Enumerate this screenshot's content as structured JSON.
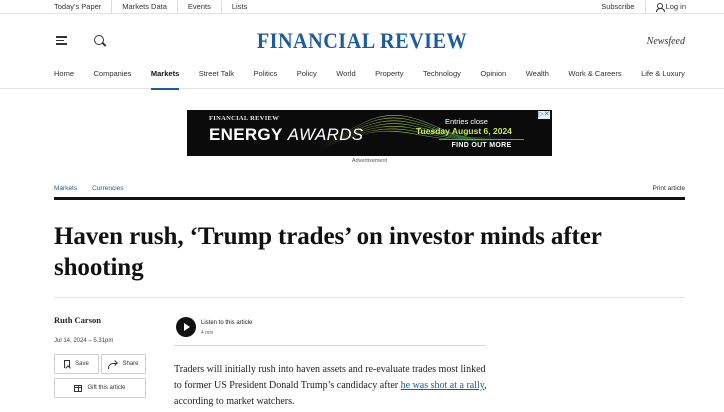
{
  "topbar": {
    "links": [
      "Today's Paper",
      "Markets Data",
      "Events",
      "Lists"
    ],
    "subscribe": "Subscribe",
    "login": "Log in"
  },
  "masthead": {
    "logo": "FINANCIAL REVIEW",
    "newsfeed": "Newsfeed",
    "accent_color": "#1d5a9f"
  },
  "nav": {
    "items": [
      "Home",
      "Companies",
      "Markets",
      "Street Talk",
      "Politics",
      "Policy",
      "World",
      "Property",
      "Technology",
      "Opinion",
      "Wealth",
      "Work & Careers",
      "Life & Luxury"
    ],
    "active": "Markets"
  },
  "ad": {
    "brand": "FINANCIAL REVIEW",
    "title_bold": "ENERGY",
    "title_italic": "AWARDS",
    "entries": "Entries close",
    "date": "Tuesday August 6, 2024",
    "cta": "FIND OUT MORE",
    "adchoices": "▷✕",
    "label": "Advertisement"
  },
  "breadcrumb": {
    "items": [
      "Markets",
      "Currencies"
    ],
    "print": "Print article"
  },
  "article": {
    "headline": "Haven rush, ‘Trump trades’ on investor minds after shooting",
    "author": "Ruth Carson",
    "date": "Jul 14, 2024 – 5.31pm",
    "save": "Save",
    "share": "Share",
    "gift": "Gift this article",
    "listen": "Listen to this article",
    "listen_duration": "4 min",
    "body_before": "Traders will initially rush into haven assets and re-evaluate trades most linked to former US President Donald Trump’s candidacy after ",
    "body_link": "he was shot at a rally",
    "body_after": ", according to market watchers."
  }
}
